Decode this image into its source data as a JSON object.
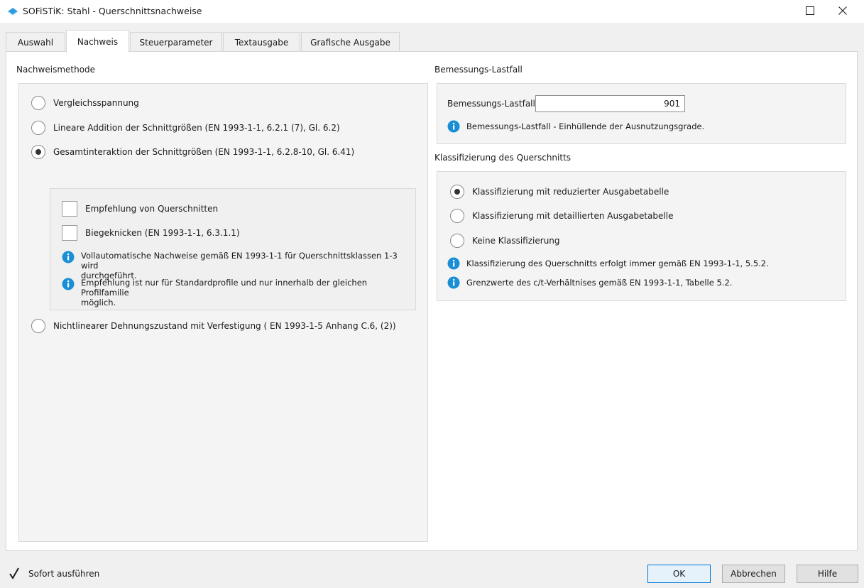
{
  "window": {
    "title": "SOFiSTiK: Stahl - Querschnittsnachweise"
  },
  "tabs": [
    {
      "label": "Auswahl",
      "active": false
    },
    {
      "label": "Nachweis",
      "active": true
    },
    {
      "label": "Steuerparameter",
      "active": false
    },
    {
      "label": "Textausgabe",
      "active": false
    },
    {
      "label": "Grafische Ausgabe",
      "active": false
    }
  ],
  "nachweis": {
    "title": "Nachweismethode",
    "options": [
      {
        "label": "Vergleichsspannung",
        "selected": false
      },
      {
        "label": "Lineare Addition der Schnittgrößen (EN 1993-1-1, 6.2.1 (7), Gl. 6.2)",
        "selected": false
      },
      {
        "label": "Gesamtinteraktion der Schnittgrößen (EN 1993-1-1, 6.2.8-10, Gl. 6.41)",
        "selected": true
      },
      {
        "label": "Nichtlinearer Dehnungszustand mit Verfestigung ( EN 1993-1-5 Anhang C.6, (2))",
        "selected": false
      }
    ],
    "sub": {
      "checkboxes": [
        {
          "label": "Empfehlung von Querschnitten",
          "checked": false
        },
        {
          "label": "Biegeknicken (EN 1993-1-1, 6.3.1.1)",
          "checked": false
        }
      ],
      "infos": [
        {
          "line1": "Vollautomatische Nachweise gemäß EN 1993-1-1 für Querschnittsklassen 1-3 wird",
          "line2": "durchgeführt."
        },
        {
          "line1": "Empfehlung ist nur für Standardprofile und nur innerhalb der gleichen Profilfamilie",
          "line2": "möglich."
        }
      ]
    }
  },
  "lastfall": {
    "title": "Bemessungs-Lastfall",
    "field_label": "Bemessungs-Lastfall:",
    "field_value": "901",
    "info": "Bemessungs-Lastfall - Einhüllende der Ausnutzungsgrade."
  },
  "klassifizierung": {
    "title": "Klassifizierung des Querschnitts",
    "options": [
      {
        "label": "Klassifizierung mit reduzierter Ausgabetabelle",
        "selected": true
      },
      {
        "label": "Klassifizierung mit detaillierten Ausgabetabelle",
        "selected": false
      },
      {
        "label": "Keine Klassifizierung",
        "selected": false
      }
    ],
    "infos": [
      "Klassifizierung des Querschnitts erfolgt immer gemäß EN 1993-1-1, 5.5.2.",
      "Grenzwerte des c/t-Verhältnises gemäß EN 1993-1-1, Tabelle 5.2."
    ]
  },
  "footer": {
    "sofort_label": "Sofort ausführen",
    "sofort_checked": true,
    "ok_label": "OK",
    "cancel_label": "Abbrechen",
    "help_label": "Hilfe"
  },
  "colors": {
    "info_icon": "#1a8fd6",
    "app_icon": "#2e9be0",
    "default_button_border": "#0078d7"
  }
}
